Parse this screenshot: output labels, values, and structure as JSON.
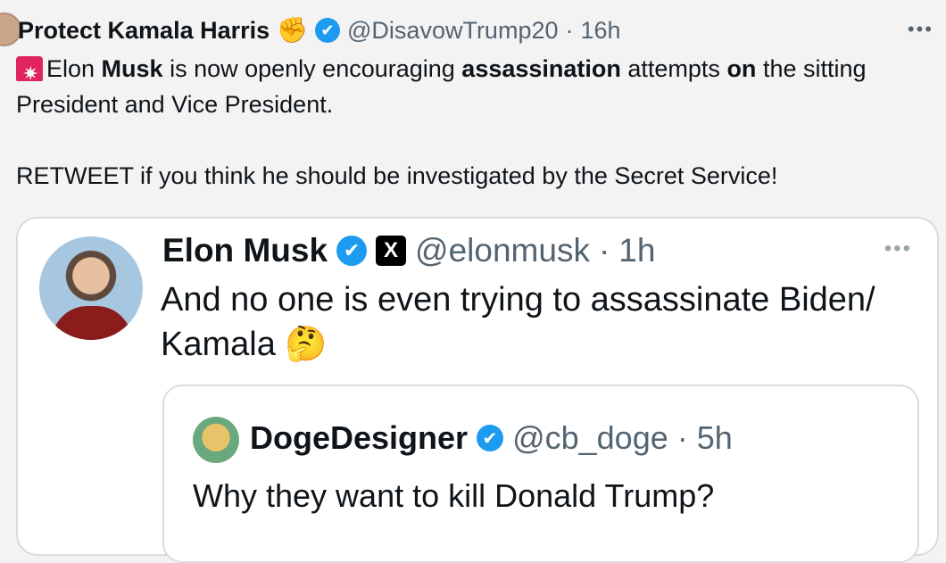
{
  "tweet": {
    "display_name": "Protect Kamala Harris",
    "fist_emoji": "✊",
    "handle": "@DisavowTrump20",
    "separator": "·",
    "time": "16h",
    "more_icon": "more-horizontal-icon",
    "more": "•••",
    "verified_icon": "✔",
    "text": {
      "siren_icon": "siren-emoji-icon",
      "seg1": "Elon ",
      "seg2": "Musk",
      "seg3": " is now openly encouraging ",
      "seg4": "assassination",
      "seg5": " attempts ",
      "seg6": "on",
      "seg7": " the sitting President and Vice President.",
      "line2": "RETWEET if you think he should be investigated by the Secret Service!"
    }
  },
  "quote": {
    "display_name": "Elon Musk",
    "verified_icon": "✔",
    "x_badge": "X",
    "handle": "@elonmusk",
    "separator": "·",
    "time": "1h",
    "more": "•••",
    "text": "And no one is even trying to assassinate Biden/ Kamala",
    "emoji": "🤔"
  },
  "inner_quote": {
    "display_name": "DogeDesigner",
    "verified_icon": "✔",
    "handle": "@cb_doge",
    "separator": "·",
    "time": "5h",
    "text": "Why they want to kill Donald Trump?"
  },
  "colors": {
    "accent": "#1d9bf0",
    "muted": "#536471",
    "siren": "#e0245e"
  }
}
